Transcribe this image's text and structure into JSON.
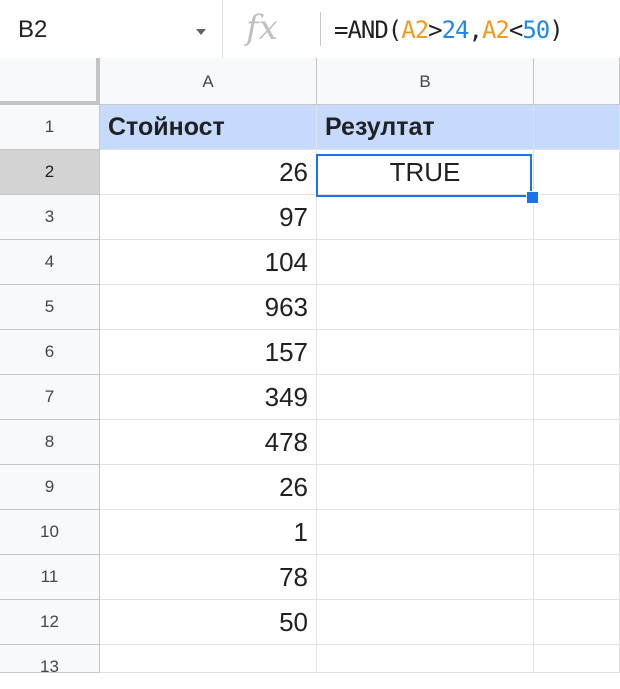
{
  "formula_bar": {
    "name_box": "B2",
    "fx_label": "fx",
    "formula_prefix": "=AND(",
    "ref1": "A2",
    "op1": ">",
    "num1": "24",
    "comma": ",",
    "ref2": "A2",
    "op2": "<",
    "num2": "50",
    "formula_suffix": ")"
  },
  "columns": [
    "A",
    "B"
  ],
  "rows": [
    "1",
    "2",
    "3",
    "4",
    "5",
    "6",
    "7",
    "8",
    "9",
    "10",
    "11",
    "12",
    "13"
  ],
  "cells": {
    "A1": "Стойност",
    "B1": "Резултат",
    "A2": "26",
    "B2": "TRUE",
    "A3": "97",
    "A4": "104",
    "A5": "963",
    "A6": "157",
    "A7": "349",
    "A8": "478",
    "A9": "26",
    "A10": "1",
    "A11": "78",
    "A12": "50"
  },
  "colors": {
    "header_fill": "#c6dafc",
    "selection": "#1a73e8",
    "ref_color": "#f09b1f",
    "number_color": "#1e88e5"
  }
}
